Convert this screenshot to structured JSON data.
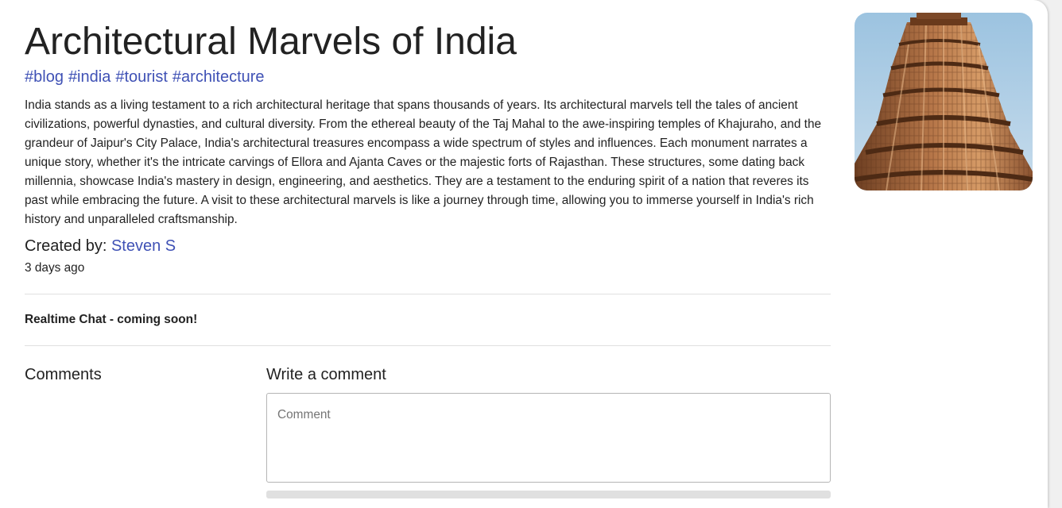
{
  "post": {
    "title": "Architectural Marvels of India",
    "tags": [
      "#blog",
      "#india",
      "#tourist",
      "#architecture"
    ],
    "body": "India stands as a living testament to a rich architectural heritage that spans thousands of years. Its architectural marvels tell the tales of ancient civilizations, powerful dynasties, and cultural diversity. From the ethereal beauty of the Taj Mahal to the awe-inspiring temples of Khajuraho, and the grandeur of Jaipur's City Palace, India's architectural treasures encompass a wide spectrum of styles and influences. Each monument narrates a unique story, whether it's the intricate carvings of Ellora and Ajanta Caves or the majestic forts of Rajasthan. These structures, some dating back millennia, showcase India's mastery in design, engineering, and aesthetics. They are a testament to the enduring spirit of a nation that reveres its past while embracing the future. A visit to these architectural marvels is like a journey through time, allowing you to immerse yourself in India's rich history and unparalleled craftsmanship.",
    "created_by_label": "Created by:",
    "author": "Steven S",
    "posted_ago": "3 days ago",
    "image_subject": "tower-photo"
  },
  "chat": {
    "note": "Realtime Chat - coming soon!"
  },
  "comments": {
    "heading": "Comments",
    "write_heading": "Write a comment",
    "placeholder": "Comment",
    "value": ""
  },
  "colors": {
    "link": "#3f51b5",
    "divider": "#e0e0e0"
  }
}
